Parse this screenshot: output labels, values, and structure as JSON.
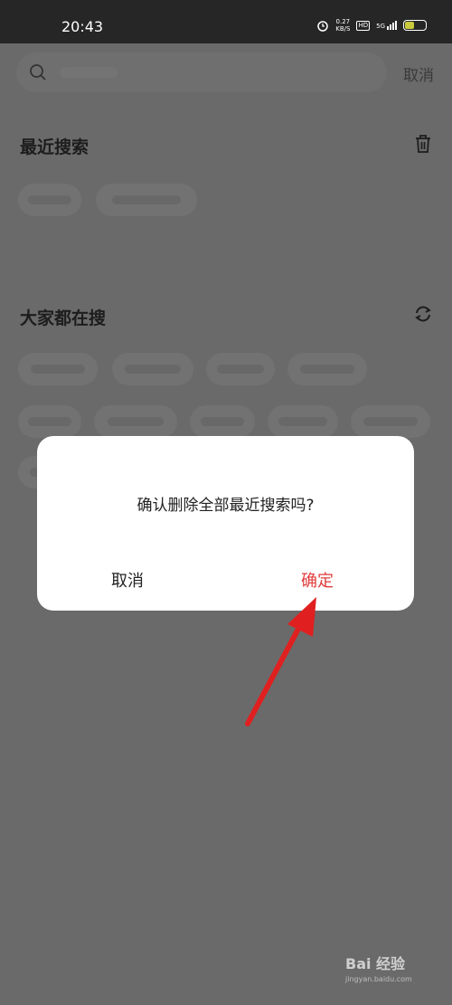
{
  "status_bar": {
    "time": "20:43",
    "net_speed": "0.27",
    "net_unit": "KB/S",
    "signal_label": "5G",
    "battery_level_percent": 45
  },
  "search": {
    "placeholder": "",
    "cancel_label": "取消"
  },
  "recent": {
    "title": "最近搜索",
    "delete_icon": "trash-icon"
  },
  "trending": {
    "title": "大家都在搜",
    "refresh_icon": "refresh-icon"
  },
  "dialog": {
    "message": "确认删除全部最近搜索吗?",
    "cancel_label": "取消",
    "confirm_label": "确定",
    "confirm_color": "#e03b3b"
  },
  "annotation": {
    "arrow_color": "#e02020"
  },
  "watermark": {
    "brand": "Bai 经验",
    "url": "jingyan.baidu.com"
  }
}
